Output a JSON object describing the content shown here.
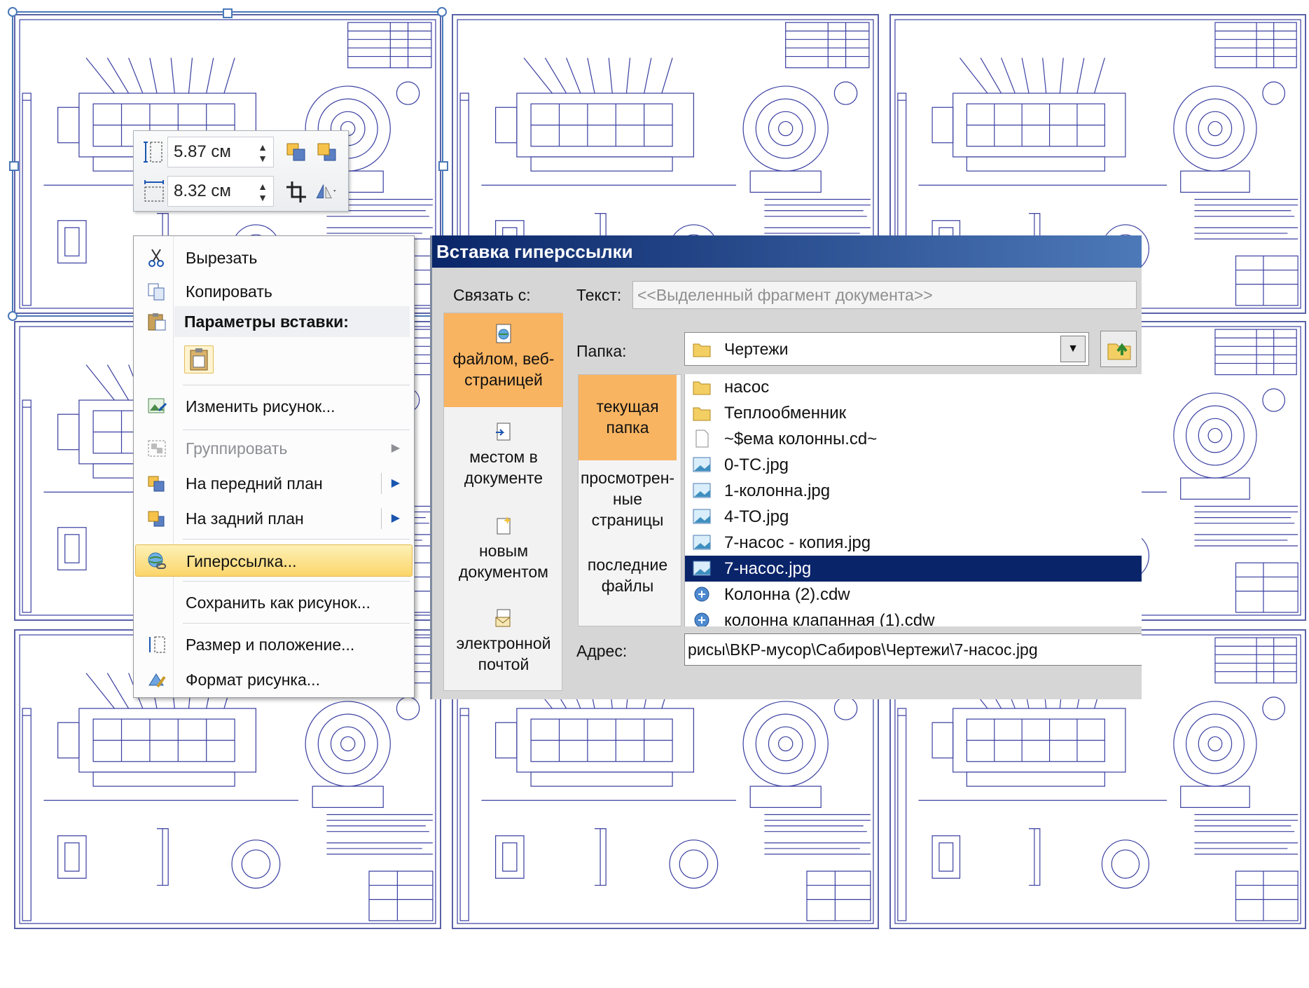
{
  "mini_toolbar": {
    "height_value": "5.87 см",
    "width_value": "8.32 см",
    "spin_arrows": "▲▼"
  },
  "context_menu": {
    "items": [
      {
        "label": "Вырезать",
        "icon": "scissors-icon"
      },
      {
        "label": "Копировать",
        "icon": "copy-icon"
      },
      {
        "label": "Изменить рисунок...",
        "icon": "change-picture-icon"
      },
      {
        "label": "Группировать",
        "icon": "group-icon",
        "disabled": true
      },
      {
        "label": "На передний план",
        "icon": "bring-forward-icon"
      },
      {
        "label": "На задний план",
        "icon": "send-backward-icon"
      },
      {
        "label": "Гиперссылка...",
        "icon": "hyperlink-icon",
        "highlighted": true
      },
      {
        "label": "Сохранить как рисунок...",
        "icon": ""
      },
      {
        "label": "Размер и положение...",
        "icon": "size-position-icon"
      },
      {
        "label": "Формат рисунка...",
        "icon": "format-picture-icon"
      }
    ],
    "paste_header": "Параметры вставки:",
    "submenu_arrow": "▶"
  },
  "dialog": {
    "title": "Вставка гиперссылки",
    "link_to_label": "Связать с:",
    "text_label": "Текст:",
    "text_value": "<<Выделенный фрагмент документа>>",
    "folder_label": "Папка:",
    "folder_value": "Чертежи",
    "combo_arrow": "▼",
    "address_label": "Адрес:",
    "address_value": "рисы\\ВКР-мусор\\Сабиров\\Чертежи\\7-насос.jpg",
    "link_options": [
      {
        "label": "файлом, веб-страницей",
        "active": true
      },
      {
        "label": "местом в документе"
      },
      {
        "label": "новым документом"
      },
      {
        "label": "электронной почтой"
      }
    ],
    "side_options": [
      {
        "label": "текущая папка",
        "active": true
      },
      {
        "label": "просмотрен-ные страницы"
      },
      {
        "label": "последние файлы"
      }
    ],
    "files": [
      {
        "name": "насос",
        "type": "folder"
      },
      {
        "name": "Теплообменник",
        "type": "folder"
      },
      {
        "name": "~$ема колонны.cd~",
        "type": "file"
      },
      {
        "name": "0-ТС.jpg",
        "type": "image"
      },
      {
        "name": "1-колонна.jpg",
        "type": "image"
      },
      {
        "name": "4-ТО.jpg",
        "type": "image"
      },
      {
        "name": "7-насос - копия.jpg",
        "type": "image"
      },
      {
        "name": "7-насос.jpg",
        "type": "image",
        "selected": true
      },
      {
        "name": "Колонна (2).cdw",
        "type": "cdw"
      },
      {
        "name": "колонна клапанная (1).cdw",
        "type": "cdw"
      }
    ]
  },
  "colors": {
    "drawing_line": "#3a3fa0",
    "selection_blue": "#0a246a",
    "highlight_orange": "#f9b461",
    "title_bar": "#0a2669"
  }
}
